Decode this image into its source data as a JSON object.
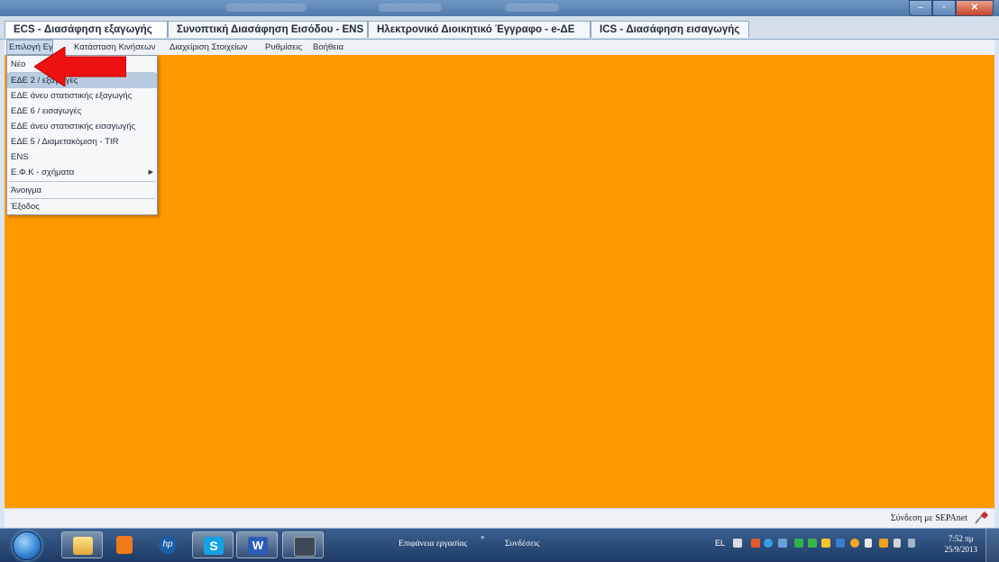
{
  "tabs": [
    {
      "label": "ECS - Διασάφηση εξαγωγής"
    },
    {
      "label": "Συνοπτική Διασάφηση Εισόδου - ENS"
    },
    {
      "label": "Ηλεκτρονικό Διοικητικό Έγγραφο - e-ΔΕ"
    },
    {
      "label": "ICS - Διασάφηση εισαγωγής"
    }
  ],
  "menubar": {
    "items": [
      {
        "label": "Επιλογή Εγγ"
      },
      {
        "label": "Κατάσταση Κινήσεων"
      },
      {
        "label": "Διαχείριση Στοιχείων"
      },
      {
        "label": "Ρυθμίσεις"
      },
      {
        "label": "Βοήθεια"
      }
    ]
  },
  "dropdown": {
    "items": [
      {
        "label": "Νέο",
        "highlighted": false
      },
      {
        "label": "ΕΔΕ 2 / εξαγωγές",
        "highlighted": true
      },
      {
        "label": "ΕΔΕ άνευ στατιστικής εξαγωγής",
        "highlighted": false
      },
      {
        "label": "ΕΔΕ 6 / εισαγωγές",
        "highlighted": false
      },
      {
        "label": "ΕΔΕ άνευ στατιστικής εισαγωγής",
        "highlighted": false
      },
      {
        "label": "ΕΔΕ 5 / Διαμετακόμιση - TIR",
        "highlighted": false
      },
      {
        "label": "ENS",
        "highlighted": false
      },
      {
        "label": "Ε.Φ.Κ - σχήματα",
        "highlighted": false,
        "submenu": true
      },
      {
        "label": "Άνοιγμα",
        "highlighted": false
      },
      {
        "label": "Έξοδος",
        "highlighted": false
      }
    ]
  },
  "statusbar": {
    "connection_text": "Σύνδεση με SEPAnet"
  },
  "taskbar": {
    "desktop_label": "Επιφάνεια εργασίας",
    "connections_label": "Συνδέσεις",
    "language": "EL",
    "clock_time": "7:52 πμ",
    "clock_date": "25/9/2013"
  },
  "colors": {
    "content_bg": "#ff9900",
    "arrow": "#ee1111",
    "menu_highlight": "#b8cbe0"
  }
}
